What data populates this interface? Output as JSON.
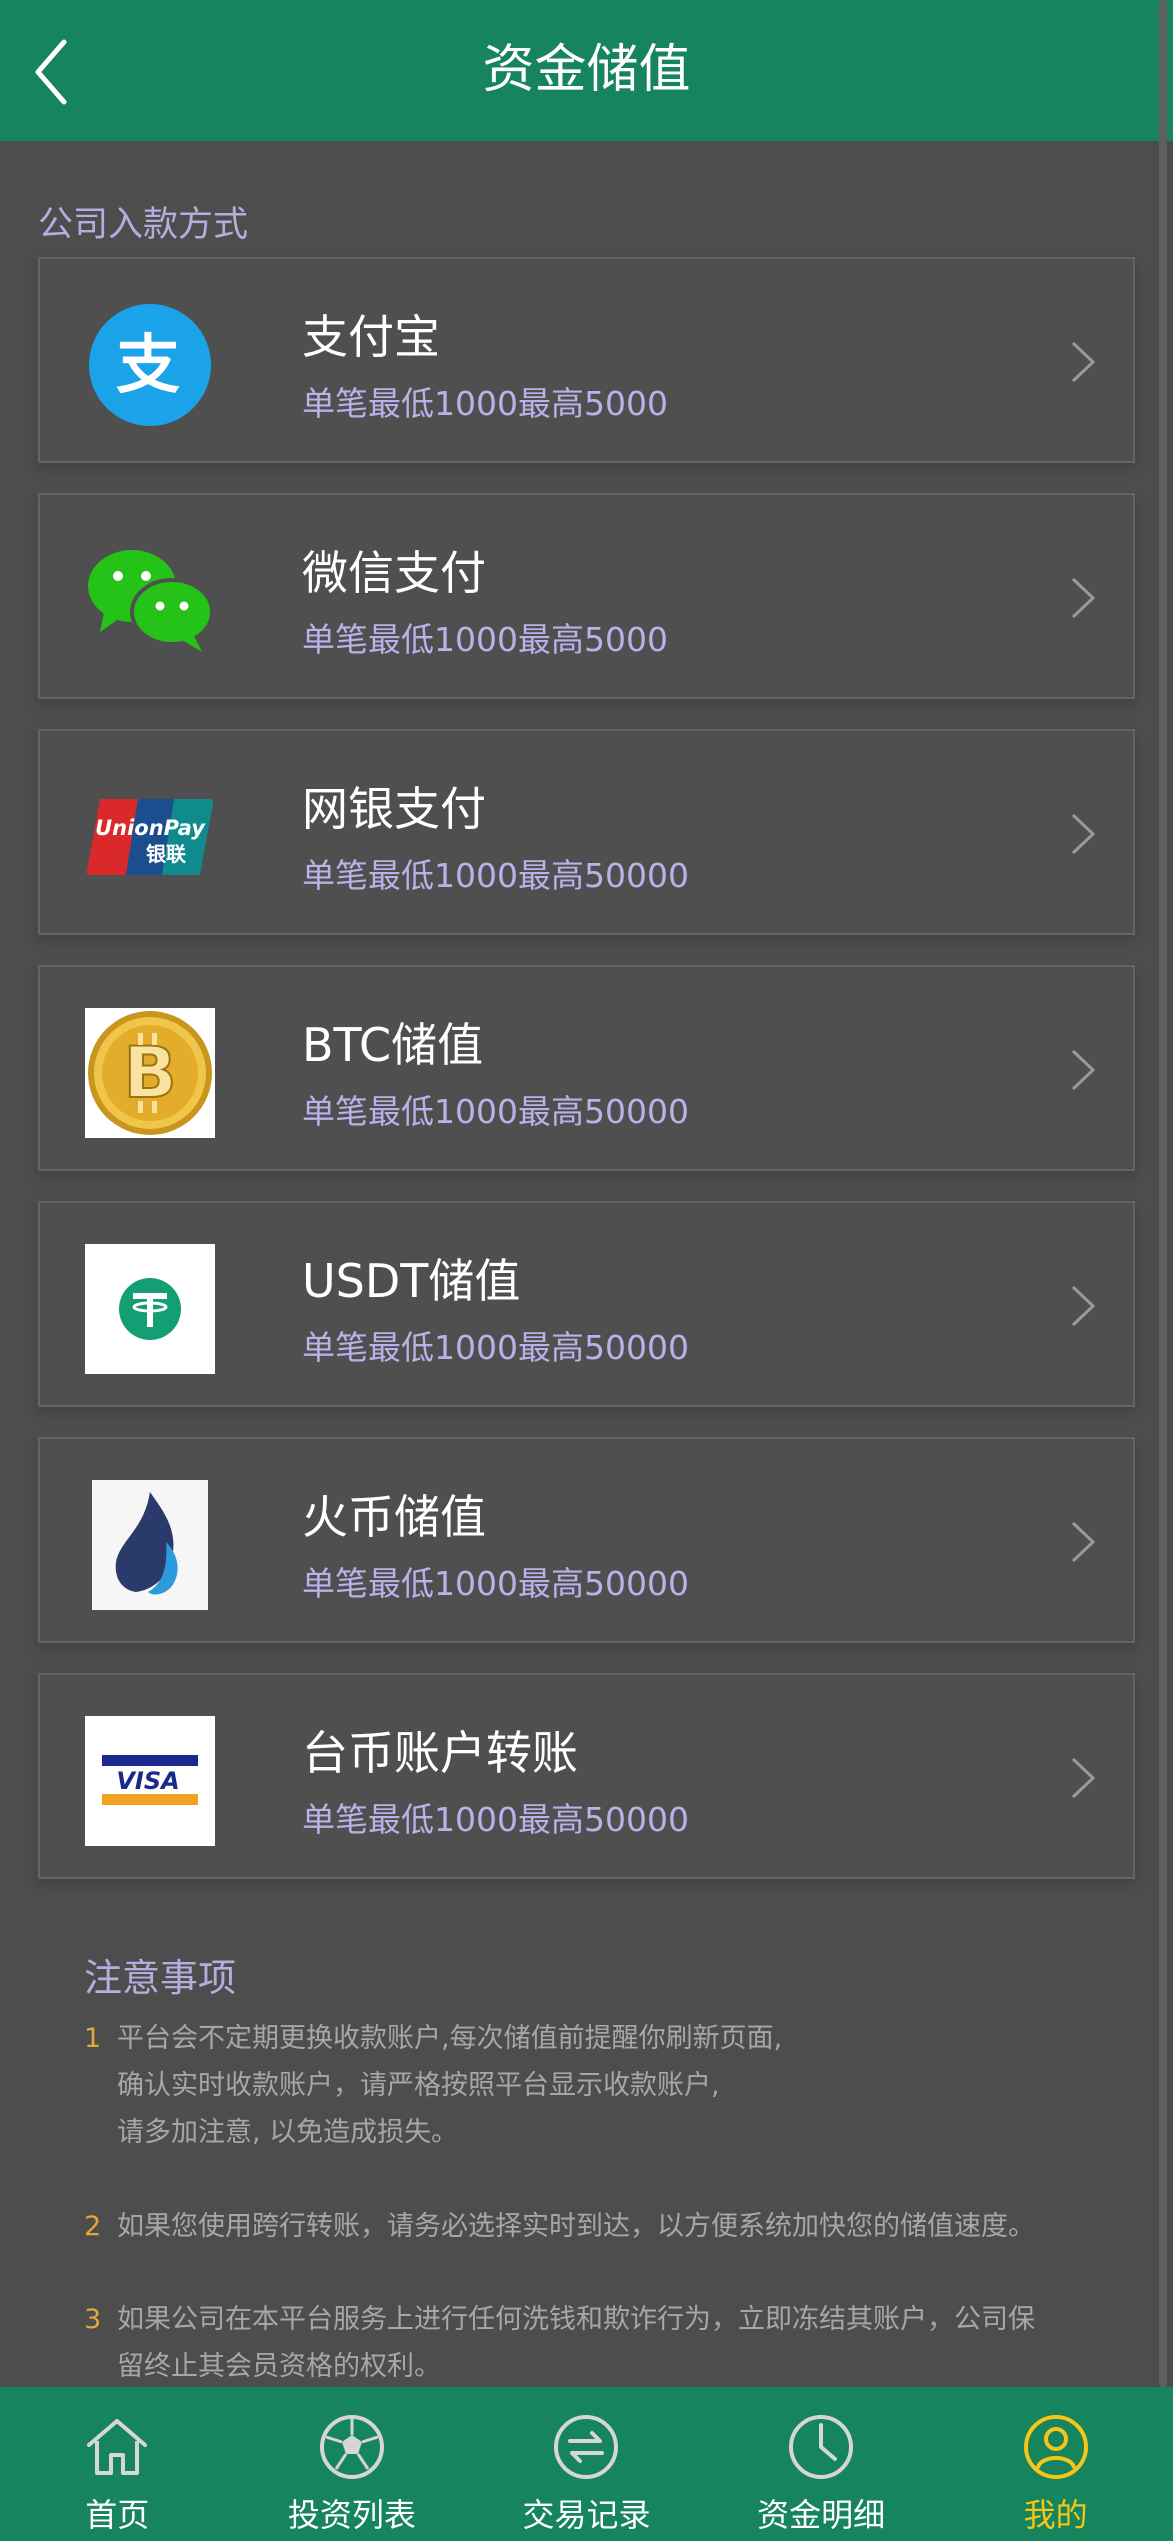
{
  "header": {
    "title": "资金储值"
  },
  "section_label": "公司入款方式",
  "methods": [
    {
      "name": "支付宝",
      "limit": "单笔最低1000最高5000",
      "icon": "alipay-icon"
    },
    {
      "name": "微信支付",
      "limit": "单笔最低1000最高5000",
      "icon": "wechat-icon"
    },
    {
      "name": "网银支付",
      "limit": "单笔最低1000最高50000",
      "icon": "unionpay-icon",
      "icon_text_1": "UnionPay",
      "icon_text_2": "银联"
    },
    {
      "name": "BTC储值",
      "limit": "单笔最低1000最高50000",
      "icon": "bitcoin-icon"
    },
    {
      "name": "USDT储值",
      "limit": "单笔最低1000最高50000",
      "icon": "tether-icon"
    },
    {
      "name": "火币储值",
      "limit": "单笔最低1000最高50000",
      "icon": "huobi-icon"
    },
    {
      "name": "台币账户转账",
      "limit": "单笔最低1000最高50000",
      "icon": "visa-icon",
      "icon_text": "VISA"
    }
  ],
  "notes": {
    "title": "注意事项",
    "items": [
      {
        "num": "1",
        "lines": [
          "平台会不定期更换收款账户,每次储值前提醒你刷新页面,",
          "确认实时收款账户，请严格按照平台显示收款账户,",
          "请多加注意, 以免造成损失。"
        ]
      },
      {
        "num": "2",
        "lines": [
          "如果您使用跨行转账，请务必选择实时到达，以方便系统加快您的储值速度。"
        ]
      },
      {
        "num": "3",
        "lines": [
          "如果公司在本平台服务上进行任何洗钱和欺诈行为，立即冻结其账户，公司保",
          "留终止其会员资格的权利。"
        ]
      }
    ]
  },
  "tabbar": {
    "items": [
      {
        "label": "首页",
        "icon": "home-icon"
      },
      {
        "label": "投资列表",
        "icon": "soccer-ball-icon"
      },
      {
        "label": "交易记录",
        "icon": "exchange-icon"
      },
      {
        "label": "资金明细",
        "icon": "clock-icon"
      },
      {
        "label": "我的",
        "icon": "user-icon",
        "active": true
      }
    ]
  },
  "colors": {
    "primary_green": "#16845d",
    "background": "#4d4d4d",
    "accent_yellow": "#f5c518",
    "limit_text": "#b7b2e8"
  }
}
